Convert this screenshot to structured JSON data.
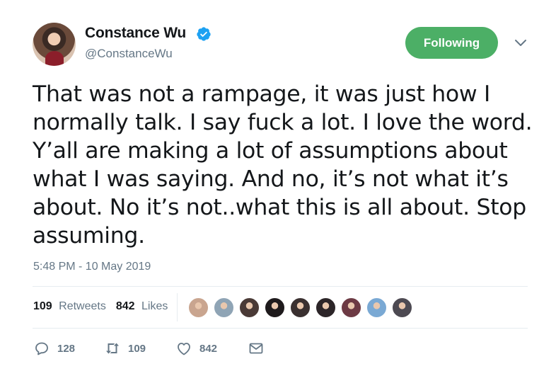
{
  "user": {
    "display_name": "Constance Wu",
    "handle": "@ConstanceWu",
    "verified": true,
    "avatar_icon": "profile-photo"
  },
  "follow_button": {
    "label": "Following",
    "color": "#4caf66"
  },
  "tweet": {
    "lines": [
      "That was not a rampage, it was just how I",
      "normally talk. I say fuck a lot. I love the word.",
      "Y’all are making a lot of assumptions about",
      "what I was saying. And no, it’s not what it’s",
      "about. No it’s not..what this is all about. Stop",
      "assuming."
    ],
    "timestamp": "5:48 PM - 10 May 2019"
  },
  "stats": {
    "retweets_count": "109",
    "retweets_label": "Retweets",
    "likes_count": "842",
    "likes_label": "Likes"
  },
  "likers": [
    {
      "icon": "liker-avatar",
      "color": "#c9a58f"
    },
    {
      "icon": "liker-avatar",
      "color": "#8fa4b5"
    },
    {
      "icon": "liker-avatar",
      "color": "#4a3a36"
    },
    {
      "icon": "liker-avatar",
      "color": "#1e1a1c"
    },
    {
      "icon": "liker-avatar",
      "color": "#3a3030"
    },
    {
      "icon": "liker-avatar",
      "color": "#2c2528"
    },
    {
      "icon": "liker-avatar",
      "color": "#6d3a44"
    },
    {
      "icon": "liker-avatar",
      "color": "#7aa9d4"
    },
    {
      "icon": "liker-avatar",
      "color": "#4d4a52"
    }
  ],
  "actions": {
    "reply_count": "128",
    "retweet_count": "109",
    "like_count": "842"
  },
  "colors": {
    "text": "#14171a",
    "secondary": "#657786",
    "verified": "#1da1f2",
    "divider": "#e6ecf0"
  }
}
